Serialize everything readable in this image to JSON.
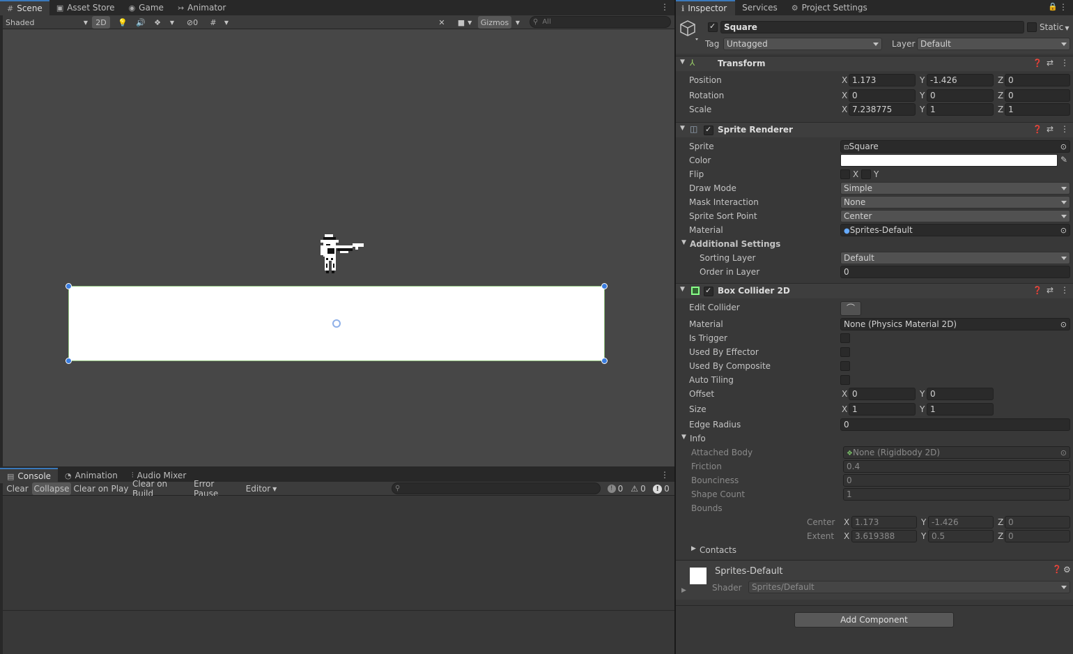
{
  "scene_tabs": [
    {
      "icon": "#",
      "label": "Scene"
    },
    {
      "icon": "▣",
      "label": "Asset Store"
    },
    {
      "icon": "◉",
      "label": "Game"
    },
    {
      "icon": "↣",
      "label": "Animator"
    }
  ],
  "scene_toolbar": {
    "shading": "Shaded",
    "two_d": "2D",
    "hidden_count": "0",
    "gizmos": "Gizmos",
    "search_placeholder": "All"
  },
  "console_tabs": [
    {
      "icon": "▤",
      "label": "Console"
    },
    {
      "icon": "◔",
      "label": "Animation"
    },
    {
      "icon": "⫶",
      "label": "Audio Mixer"
    }
  ],
  "console_toolbar": {
    "clear": "Clear",
    "collapse": "Collapse",
    "clear_on_play": "Clear on Play",
    "clear_on_build": "Clear on Build",
    "error_pause": "Error Pause",
    "editor": "Editor",
    "log_count": "0",
    "warn_count": "0",
    "error_count": "0"
  },
  "inspector_tabs": [
    {
      "icon": "ℹ",
      "label": "Inspector"
    },
    {
      "icon": "",
      "label": "Services"
    },
    {
      "icon": "⚙",
      "label": "Project Settings"
    }
  ],
  "object": {
    "name": "Square",
    "static_label": "Static",
    "tag_label": "Tag",
    "tag": "Untagged",
    "layer_label": "Layer",
    "layer": "Default"
  },
  "transform": {
    "title": "Transform",
    "position_label": "Position",
    "position": {
      "x": "1.173",
      "y": "-1.426",
      "z": "0"
    },
    "rotation_label": "Rotation",
    "rotation": {
      "x": "0",
      "y": "0",
      "z": "0"
    },
    "scale_label": "Scale",
    "scale": {
      "x": "7.238775",
      "y": "1",
      "z": "1"
    }
  },
  "sprite_renderer": {
    "title": "Sprite Renderer",
    "sprite_label": "Sprite",
    "sprite": "Square",
    "color_label": "Color",
    "color": "#ffffff",
    "flip_label": "Flip",
    "flip_x": "X",
    "flip_y": "Y",
    "draw_mode_label": "Draw Mode",
    "draw_mode": "Simple",
    "mask_label": "Mask Interaction",
    "mask": "None",
    "sort_point_label": "Sprite Sort Point",
    "sort_point": "Center",
    "material_label": "Material",
    "material": "Sprites-Default",
    "additional_label": "Additional Settings",
    "sorting_layer_label": "Sorting Layer",
    "sorting_layer": "Default",
    "order_label": "Order in Layer",
    "order": "0"
  },
  "box_collider": {
    "title": "Box Collider 2D",
    "edit_label": "Edit Collider",
    "material_label": "Material",
    "material": "None (Physics Material 2D)",
    "is_trigger_label": "Is Trigger",
    "effector_label": "Used By Effector",
    "composite_label": "Used By Composite",
    "auto_tiling_label": "Auto Tiling",
    "offset_label": "Offset",
    "offset": {
      "x": "0",
      "y": "0"
    },
    "size_label": "Size",
    "size": {
      "x": "1",
      "y": "1"
    },
    "edge_label": "Edge Radius",
    "edge": "0",
    "info_label": "Info",
    "attached_label": "Attached Body",
    "attached": "None (Rigidbody 2D)",
    "friction_label": "Friction",
    "friction": "0.4",
    "bounciness_label": "Bounciness",
    "bounciness": "0",
    "shape_count_label": "Shape Count",
    "shape_count": "1",
    "bounds_label": "Bounds",
    "center_label": "Center",
    "center": {
      "x": "1.173",
      "y": "-1.426",
      "z": "0"
    },
    "extent_label": "Extent",
    "extent": {
      "x": "3.619388",
      "y": "0.5",
      "z": "0"
    },
    "contacts_label": "Contacts"
  },
  "material_block": {
    "name": "Sprites-Default",
    "shader_label": "Shader",
    "shader": "Sprites/Default"
  },
  "add_component": "Add Component",
  "axes": {
    "x": "X",
    "y": "Y",
    "z": "Z"
  }
}
